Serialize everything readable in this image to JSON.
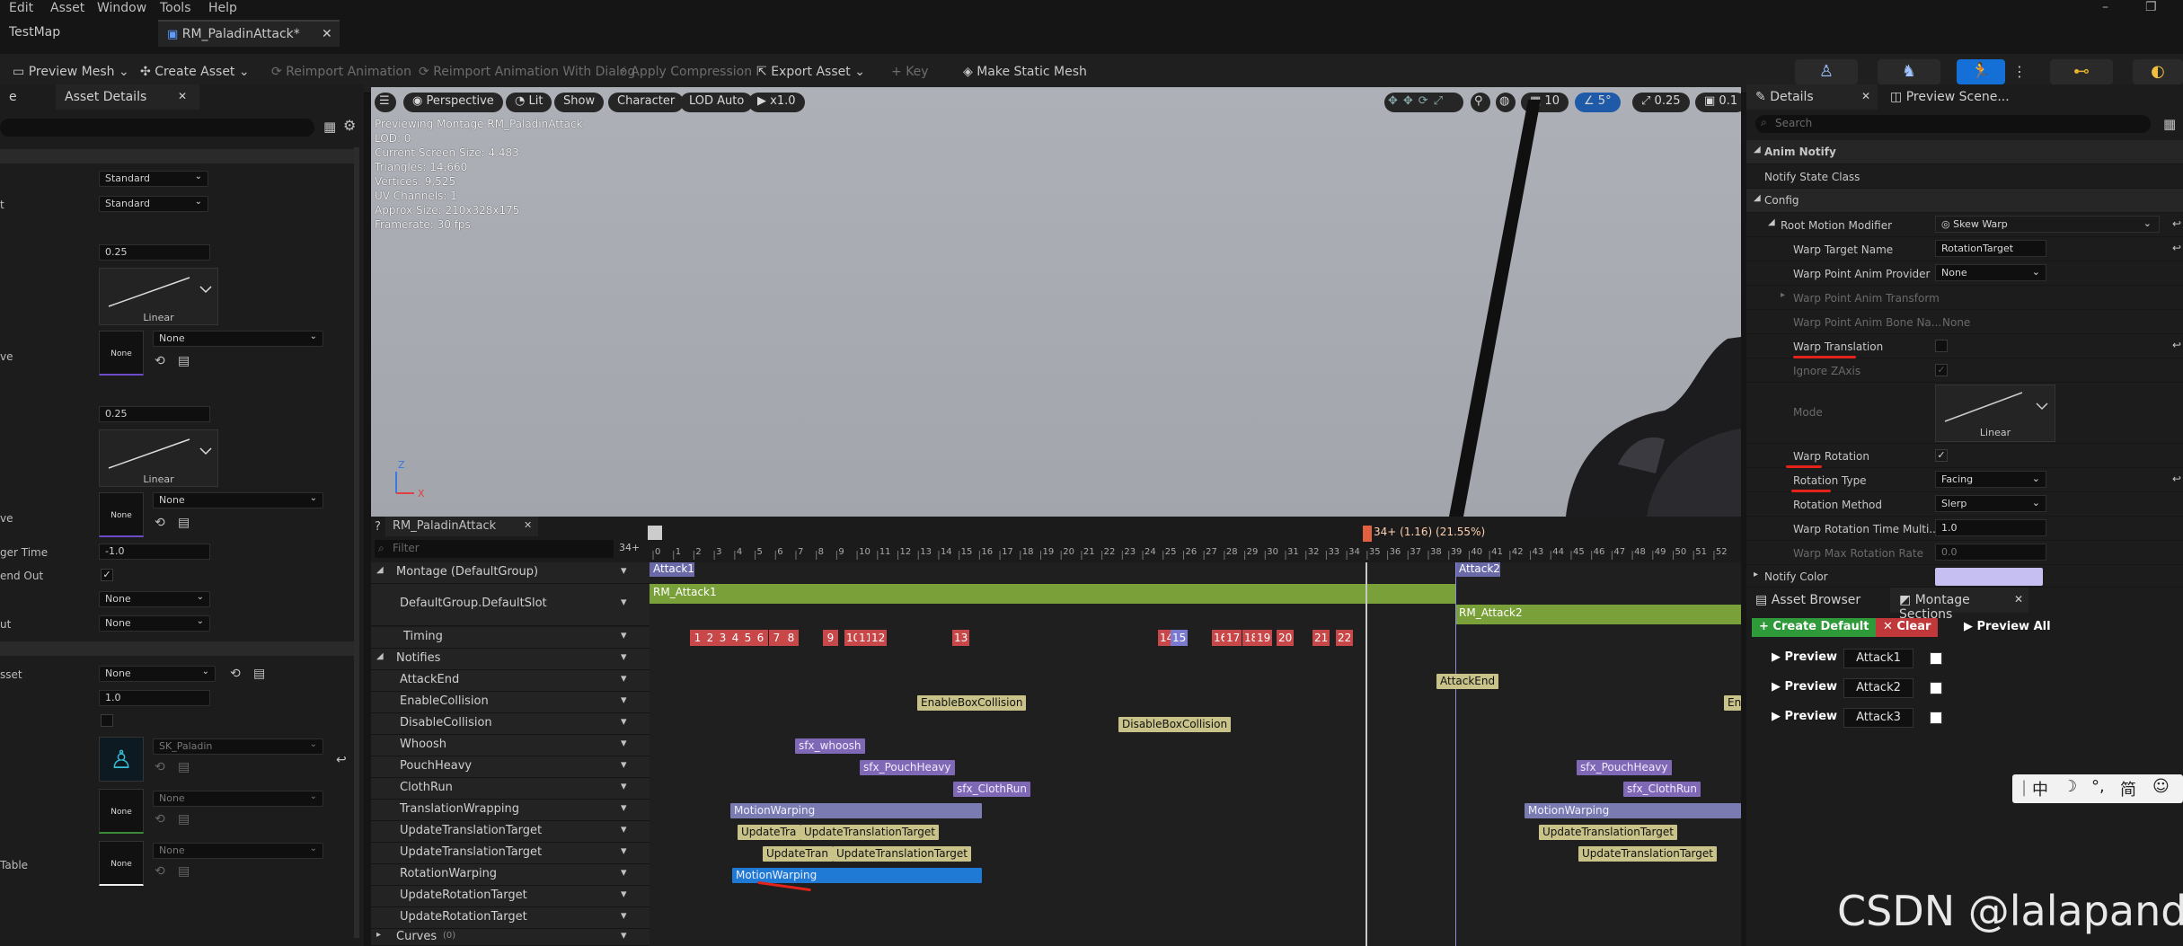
{
  "menubar": {
    "items": [
      "Edit",
      "Asset",
      "Window",
      "Tools",
      "Help"
    ]
  },
  "tabs": {
    "left": "TestMap",
    "active": "RM_PaladinAttack*"
  },
  "toolbar": {
    "preview_mesh": "Preview Mesh",
    "create_asset": "Create Asset",
    "reimport_animation": "Reimport Animation",
    "reimport_dialog": "Reimport Animation With Dialog",
    "apply_compression": "Apply Compression",
    "export_asset": "Export Asset",
    "key": "Key",
    "make_static_mesh": "Make Static Mesh"
  },
  "left_panel": {
    "tab_cut": "e",
    "tab_asset_details": "Asset Details",
    "rows": [
      {
        "label": "",
        "value": "Standard"
      },
      {
        "label": "t",
        "value": "Standard"
      },
      {
        "label": "",
        "value": "0.25"
      },
      {
        "label": "",
        "curve_label": "Linear"
      },
      {
        "label": "ve",
        "thumb": "None",
        "combo": "None"
      },
      {
        "label": "",
        "value": "0.25"
      },
      {
        "label": "",
        "curve_label": "Linear"
      },
      {
        "label": "ve",
        "thumb": "None",
        "combo": "None"
      },
      {
        "label": "ger Time",
        "value": "-1.0"
      },
      {
        "label": "end Out"
      },
      {
        "label": "",
        "combo": "None"
      },
      {
        "label": "ut",
        "combo": "None"
      },
      {
        "label": "sset",
        "combo": "None"
      },
      {
        "label": "",
        "value": "1.0"
      },
      {
        "label": "",
        "combo": "SK_Paladin"
      },
      {
        "label": "",
        "thumb": "None",
        "combo": "None"
      },
      {
        "label": "Table",
        "thumb": "None",
        "combo": "None"
      }
    ]
  },
  "viewport": {
    "menu_icon": "hamburger-icon",
    "perspective": "Perspective",
    "lit": "Lit",
    "show": "Show",
    "character": "Character",
    "lod": "LOD Auto",
    "speed": "x1.0",
    "grid_value": "10",
    "angle_value": "5°",
    "scale_value": "0.25",
    "camera_value": "0.1",
    "stats": [
      "Previewing Montage RM_PaladinAttack",
      "LOD: 0",
      "Current Screen Size: 4.483",
      "Triangles: 14,660",
      "Vertices: 9,525",
      "UV Channels: 1",
      "Approx Size: 210x328x175",
      "Framerate: 30 fps"
    ],
    "axis_z": "Z",
    "axis_x": "X"
  },
  "montage": {
    "tab": "RM_PaladinAttack",
    "filter_placeholder": "Filter",
    "frame_counter": "34+",
    "playhead_label": "34+ (1.16) (21.55%)",
    "ticks": [
      "0",
      "1",
      "2",
      "3",
      "4",
      "5",
      "6",
      "7",
      "8",
      "9",
      "10",
      "11",
      "12",
      "13",
      "14",
      "15",
      "16",
      "17",
      "18",
      "19",
      "20",
      "21",
      "22",
      "23",
      "24",
      "25",
      "26",
      "27",
      "28",
      "29",
      "30",
      "31",
      "32",
      "33",
      "34",
      "35",
      "36",
      "37",
      "38",
      "39",
      "40",
      "41",
      "42",
      "43",
      "44",
      "45",
      "46",
      "47",
      "48",
      "49",
      "50",
      "51",
      "52"
    ],
    "tracks": {
      "montage": "Montage (DefaultGroup)",
      "slot": "DefaultGroup.DefaultSlot",
      "timing": "Timing",
      "notifies": "Notifies",
      "attack_end": "AttackEnd",
      "enable_collision": "EnableCollision",
      "disable_collision": "DisableCollision",
      "whoosh": "Whoosh",
      "pouch_heavy": "PouchHeavy",
      "cloth_run": "ClothRun",
      "translation_wrapping": "TranslationWrapping",
      "update_translation_target_1": "UpdateTranslationTarget",
      "update_translation_target_2": "UpdateTranslationTarget",
      "rotation_warping": "RotationWarping",
      "update_rotation_target_1": "UpdateRotationTarget",
      "update_rotation_target_2": "UpdateRotationTarget",
      "curves": "Curves",
      "curves_count": "(0)"
    },
    "sections": {
      "attack1": "Attack1",
      "attack2": "Attack2"
    },
    "slots": {
      "rm_attack1": "RM_Attack1",
      "rm_attack2": "RM_Attack2"
    },
    "timing_markers": [
      "1",
      "2",
      "3",
      "4",
      "5",
      "6",
      "7",
      "8",
      "9",
      "10",
      "11",
      "12",
      "13",
      "14",
      "15",
      "16",
      "17",
      "18",
      "19",
      "20",
      "21",
      "22"
    ],
    "notifies": {
      "attack_end": "AttackEnd",
      "enable_box_collision": "EnableBoxCollision",
      "enable_cut": "En",
      "disable_box_collision": "DisableBoxCollision",
      "sfx_whoosh": "sfx_whoosh",
      "sfx_pouch_heavy": "sfx_PouchHeavy",
      "sfx_cloth_run": "sfx_ClothRun",
      "motion_warping": "MotionWarping",
      "update_trans_cut": "UpdateTra",
      "update_trans_cut2": "UpdateTran",
      "update_translation_target": "UpdateTranslationTarget"
    }
  },
  "details": {
    "tab": "Details",
    "preview_tab": "Preview Scene...",
    "search_placeholder": "Search",
    "anim_notify": "Anim Notify",
    "notify_state_class": "Notify State Class",
    "config": "Config",
    "root_motion_modifier": "Root Motion Modifier",
    "skew_warp": "Skew Warp",
    "warp_target_name": "Warp Target Name",
    "warp_target_value": "RotationTarget",
    "warp_point_provider": "Warp Point Anim Provider",
    "warp_point_provider_value": "None",
    "warp_point_transform": "Warp Point Anim Transform",
    "warp_point_bone": "Warp Point Anim Bone Na...",
    "warp_point_bone_value": "None",
    "warp_translation": "Warp Translation",
    "ignore_z": "Ignore ZAxis",
    "mode": "Mode",
    "mode_curve": "Linear",
    "warp_rotation": "Warp Rotation",
    "rotation_type": "Rotation Type",
    "rotation_type_value": "Facing",
    "rotation_method": "Rotation Method",
    "rotation_method_value": "Slerp",
    "warp_rotation_time": "Warp Rotation Time Multi...",
    "warp_rotation_time_value": "1.0",
    "warp_max_rotation": "Warp Max Rotation Rate",
    "warp_max_rotation_value": "0.0",
    "notify_color": "Notify Color"
  },
  "sections_panel": {
    "asset_browser": "Asset Browser",
    "montage_sections": "Montage Sections",
    "create_default": "Create Default",
    "clear": "Clear",
    "preview_all": "Preview All",
    "rows": [
      {
        "preview": "Preview",
        "name": "Attack1"
      },
      {
        "preview": "Preview",
        "name": "Attack2"
      },
      {
        "preview": "Preview",
        "name": "Attack3"
      }
    ]
  },
  "ime": {
    "chars": "中"
  },
  "watermark": "CSDN @lalapanda",
  "colors": {
    "accent_blue": "#1f7ad6",
    "timing_red": "#c8484a",
    "slot_green": "#7aa03a",
    "annotation_red": "#e2231a"
  }
}
